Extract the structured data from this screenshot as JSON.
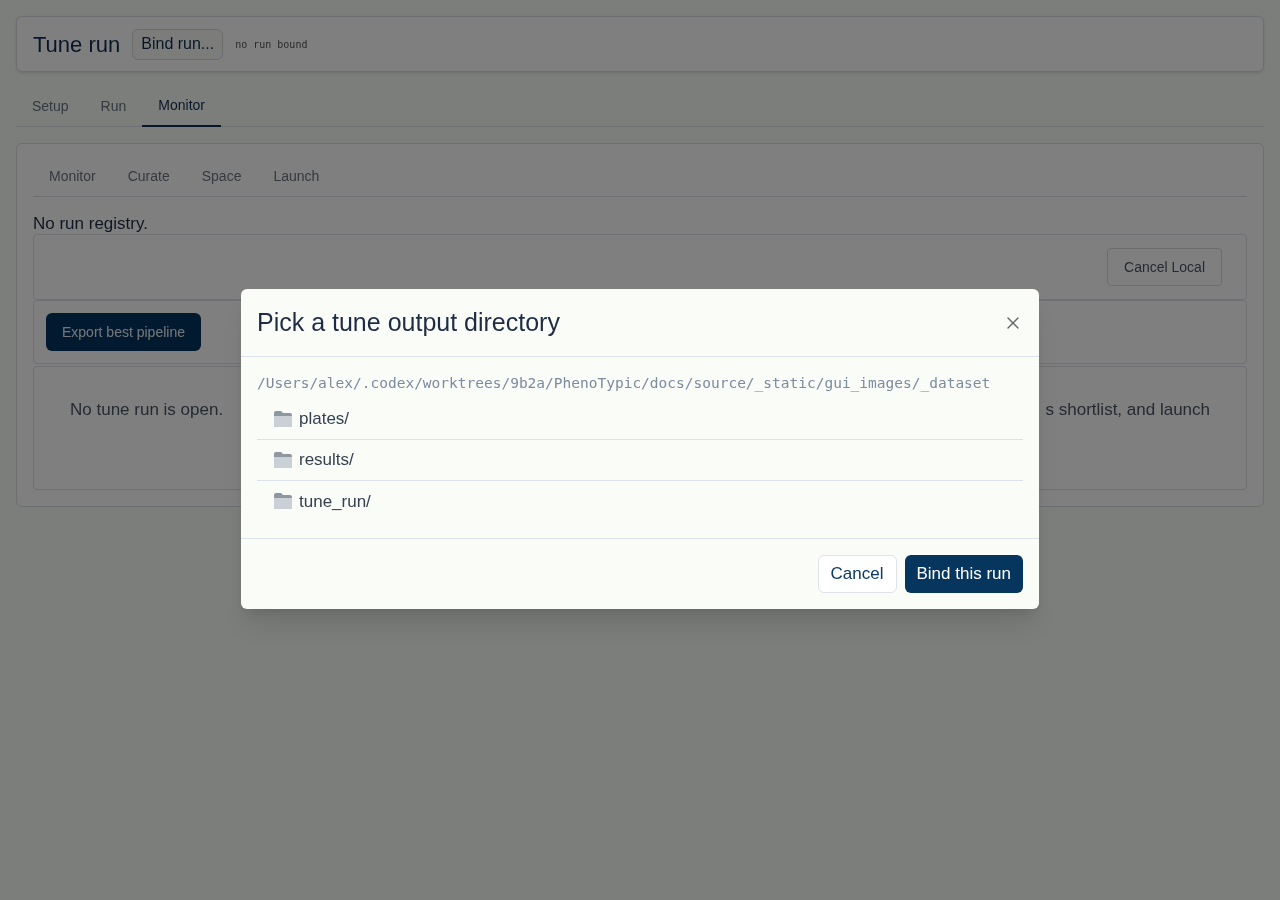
{
  "header": {
    "title": "Tune run",
    "bind_button": "Bind run...",
    "status": "no run bound"
  },
  "tabs": [
    {
      "label": "Setup",
      "selected": false
    },
    {
      "label": "Run",
      "selected": false
    },
    {
      "label": "Monitor",
      "selected": true
    }
  ],
  "panel": {
    "subtabs": [
      "Monitor",
      "Curate",
      "Space",
      "Launch"
    ],
    "registry_message": "No run registry.",
    "cancel_button": "Cancel Local",
    "export_button": "Export best pipeline",
    "empty_message_left": "No tune run is open.",
    "empty_message_right": "s shortlist, and launch"
  },
  "dialog": {
    "title": "Pick a tune output directory",
    "path": "/Users/alex/.codex/worktrees/9b2a/PhenoTypic/docs/source/_static/gui_images/_dataset",
    "entries": [
      {
        "name": "plates/"
      },
      {
        "name": "results/"
      },
      {
        "name": "tune_run/"
      }
    ],
    "buttons": [
      {
        "label": "Cancel",
        "kind": "secondary"
      },
      {
        "label": "Bind this run",
        "kind": "primary"
      }
    ]
  }
}
